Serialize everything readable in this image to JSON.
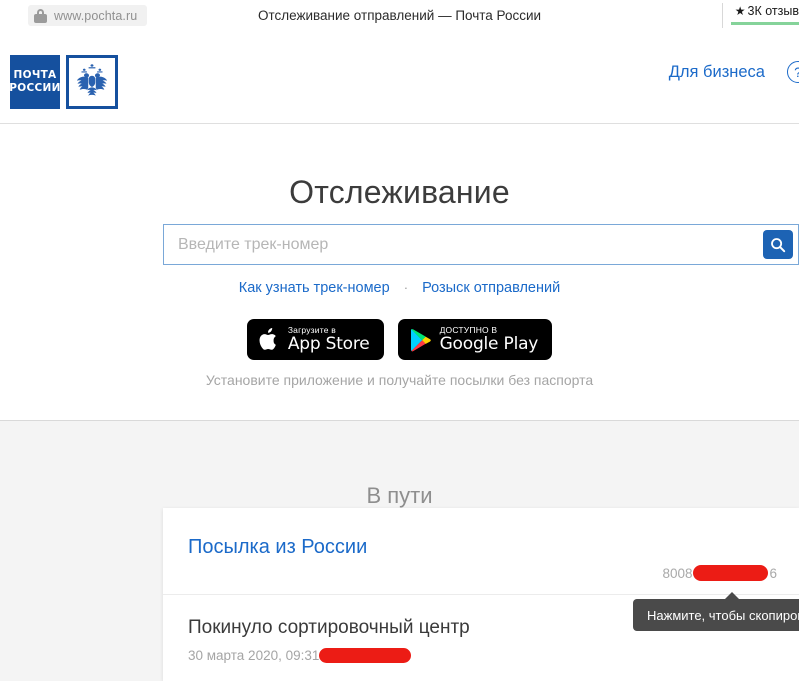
{
  "browser": {
    "url": "www.pochta.ru",
    "page_title": "Отслеживание отправлений — Почта России",
    "lock_icon": "lock-icon",
    "review_badge": {
      "star": "★",
      "text": "3К отзыв"
    }
  },
  "header": {
    "logo": {
      "line1": "ПОЧТА",
      "line2": "РОССИИ",
      "emblem": "double-headed-eagle-icon"
    },
    "business_link": "Для бизнеса",
    "help_icon": "?"
  },
  "hero": {
    "title": "Отслеживание",
    "search": {
      "placeholder": "Введите трек-номер",
      "value": "",
      "button_icon": "search-icon"
    },
    "links": [
      {
        "label": "Как узнать трек-номер"
      },
      {
        "label": "Розыск отправлений"
      }
    ],
    "separator": "·",
    "badges": [
      {
        "top": "Загрузите в",
        "bottom": "App Store",
        "icon": "apple-icon"
      },
      {
        "top": "ДОСТУПНО В",
        "bottom": "Google Play",
        "icon": "google-play-icon"
      }
    ],
    "caption": "Установите приложение и получайте посылки без паспорта"
  },
  "transit": {
    "heading": "В пути",
    "parcel": {
      "title": "Посылка из России",
      "track_prefix": "8008",
      "track_suffix": "6",
      "status_title": "Покинуло сортировочный центр",
      "status_date": "30 марта 2020, 09:31"
    },
    "tooltip": "Нажмите, чтобы скопировать"
  },
  "colors": {
    "brand_blue": "#15509e",
    "link_blue": "#1b6ac9",
    "button_blue": "#1d63b4",
    "redaction_red": "#ec1c15",
    "review_green": "#85d39a",
    "section_grey": "#f4f4f4"
  }
}
